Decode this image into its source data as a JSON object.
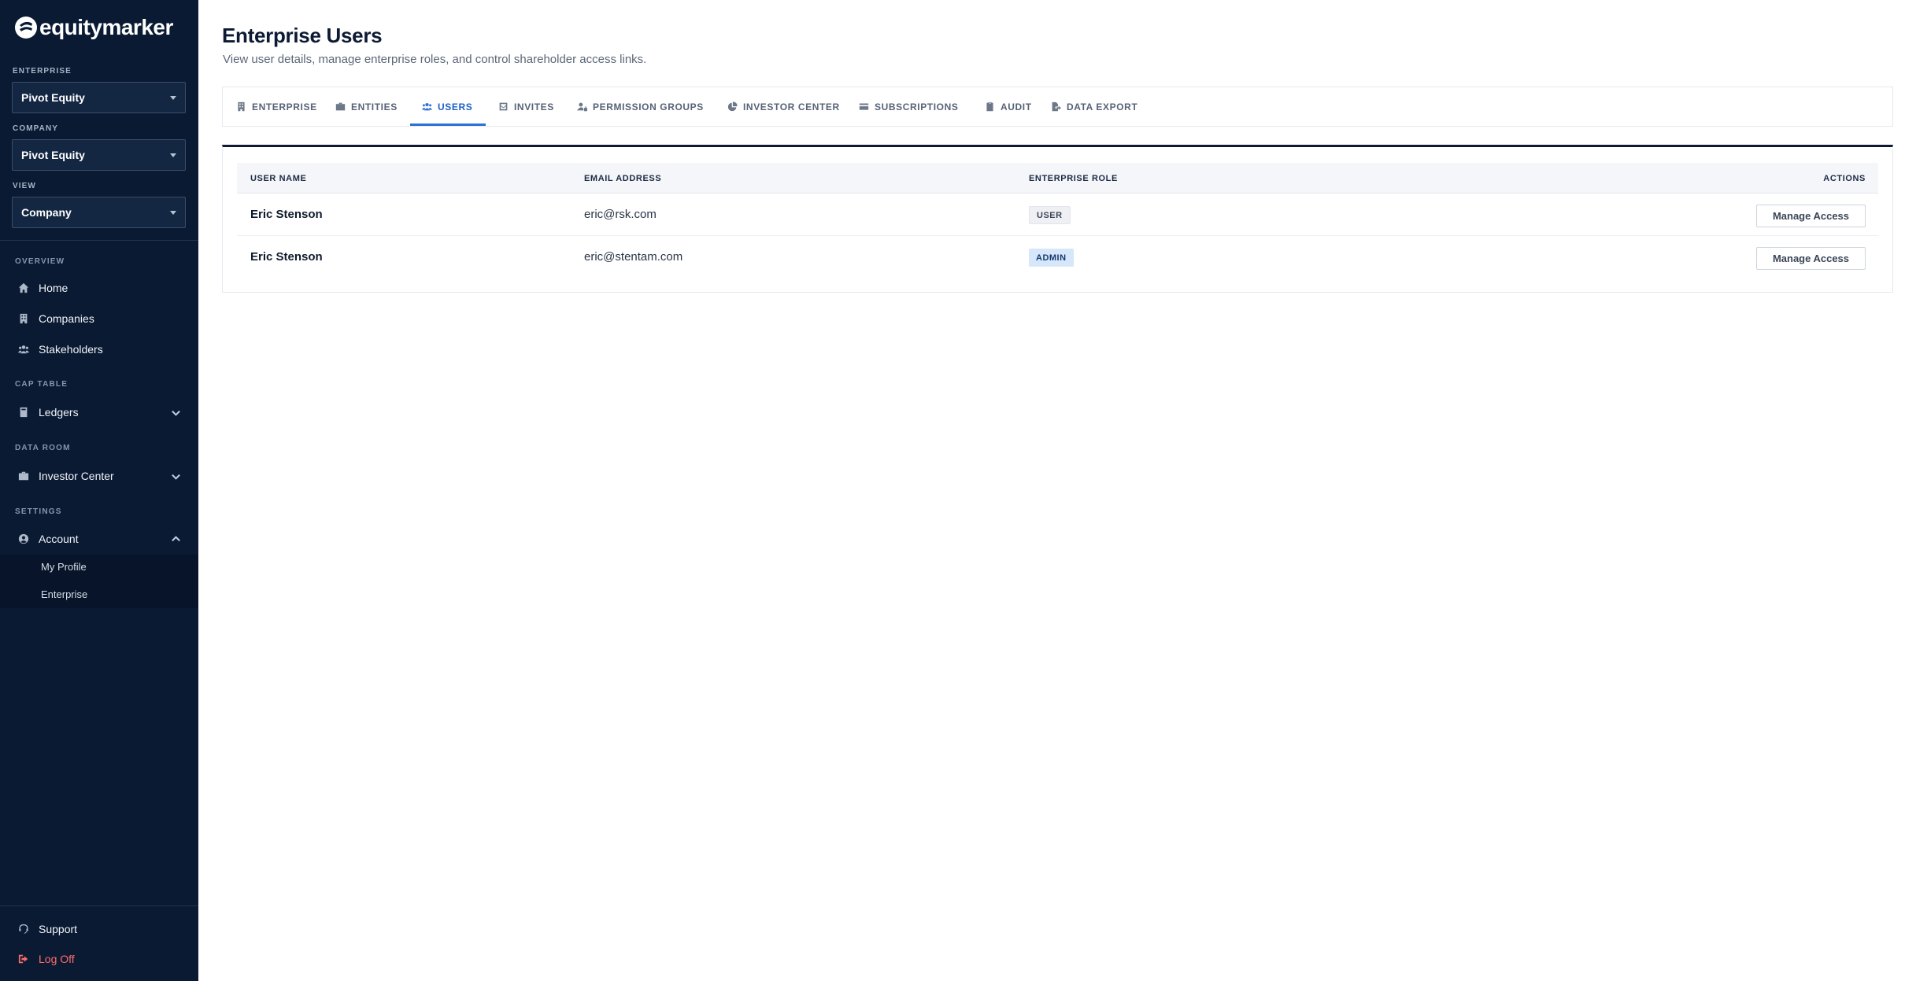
{
  "brand": {
    "name": "equitymarker"
  },
  "sidebar": {
    "enterprise_label": "ENTERPRISE",
    "enterprise_value": "Pivot Equity",
    "company_label": "COMPANY",
    "company_value": "Pivot Equity",
    "view_label": "VIEW",
    "view_value": "Company",
    "overview_label": "OVERVIEW",
    "home": "Home",
    "companies": "Companies",
    "stakeholders": "Stakeholders",
    "cap_table_label": "CAP TABLE",
    "ledgers": "Ledgers",
    "data_room_label": "DATA ROOM",
    "investor_center": "Investor Center",
    "settings_label": "SETTINGS",
    "account": "Account",
    "my_profile": "My Profile",
    "enterprise_sub": "Enterprise",
    "support": "Support",
    "log_off": "Log Off"
  },
  "page": {
    "title": "Enterprise Users",
    "subtitle": "View user details, manage enterprise roles, and control shareholder access links."
  },
  "tabs": [
    {
      "label": "ENTERPRISE",
      "icon": "building-icon"
    },
    {
      "label": "ENTITIES",
      "icon": "briefcase-icon"
    },
    {
      "label": "USERS",
      "icon": "users-icon",
      "active": true
    },
    {
      "label": "INVITES",
      "icon": "envelope-icon"
    },
    {
      "label": "PERMISSION GROUPS",
      "icon": "user-lock-icon"
    },
    {
      "label": "INVESTOR CENTER",
      "icon": "pie-chart-icon"
    },
    {
      "label": "SUBSCRIPTIONS",
      "icon": "credit-card-icon"
    },
    {
      "label": "AUDIT",
      "icon": "clipboard-icon"
    },
    {
      "label": "DATA EXPORT",
      "icon": "file-export-icon"
    }
  ],
  "table": {
    "headers": {
      "name": "USER NAME",
      "email": "EMAIL ADDRESS",
      "role": "ENTERPRISE ROLE",
      "actions": "ACTIONS"
    },
    "rows": [
      {
        "name": "Eric Stenson",
        "email": "eric@rsk.com",
        "role": "USER",
        "action": "Manage Access"
      },
      {
        "name": "Eric Stenson",
        "email": "eric@stentam.com",
        "role": "ADMIN",
        "action": "Manage Access"
      }
    ]
  },
  "colors": {
    "sidebar_bg": "#0a1a33",
    "accent": "#2c6fd6",
    "logoff": "#ff6b6b"
  }
}
